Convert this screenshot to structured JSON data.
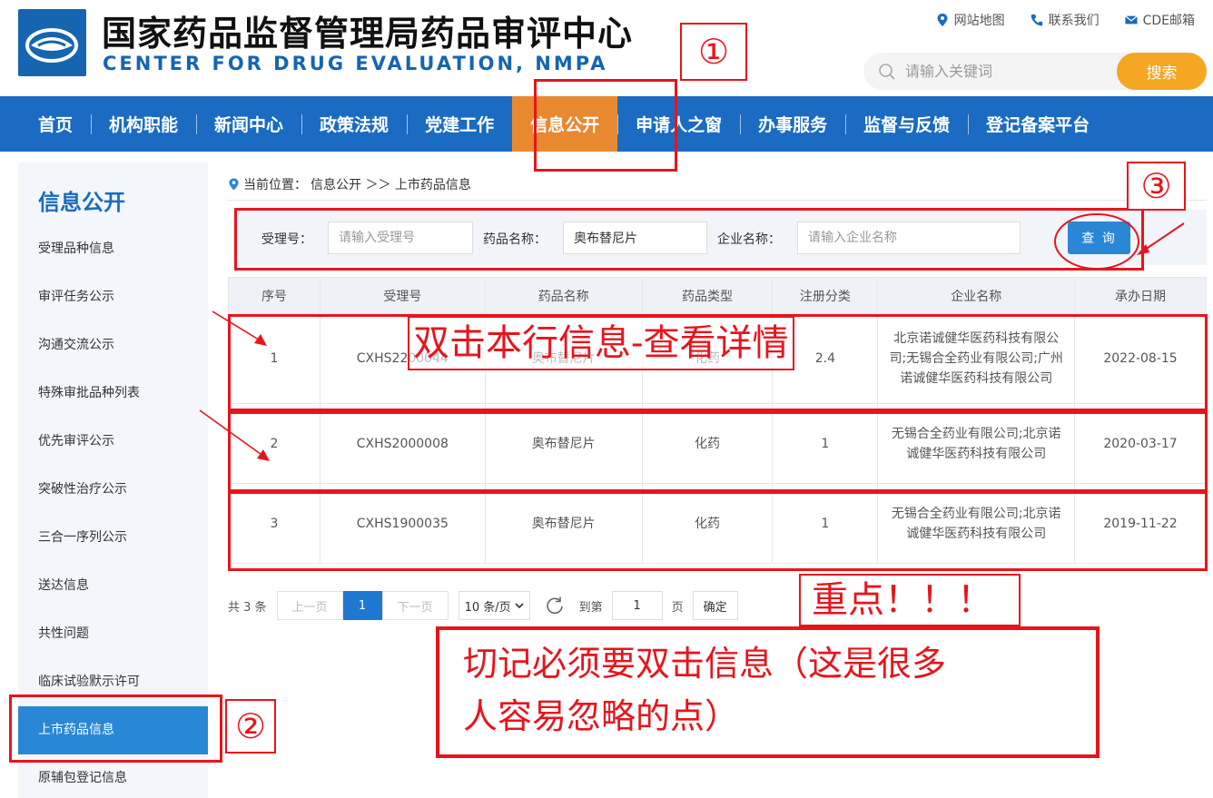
{
  "header": {
    "title_cn": "国家药品监督管理局药品审评中心",
    "title_en": "CENTER FOR DRUG EVALUATION, NMPA",
    "links": [
      {
        "label": "网站地图",
        "icon": "location-pin-icon"
      },
      {
        "label": "联系我们",
        "icon": "phone-icon"
      },
      {
        "label": "CDE邮箱",
        "icon": "mail-icon"
      }
    ],
    "search_placeholder": "请输入关键词",
    "search_button": "搜索"
  },
  "nav": {
    "items": [
      "首页",
      "机构职能",
      "新闻中心",
      "政策法规",
      "党建工作",
      "信息公开",
      "申请人之窗",
      "办事服务",
      "监督与反馈",
      "登记备案平台"
    ],
    "active": "信息公开"
  },
  "sidebar": {
    "title": "信息公开",
    "items": [
      "受理品种信息",
      "审评任务公示",
      "沟通交流公示",
      "特殊审批品种列表",
      "优先审评公示",
      "突破性治疗公示",
      "三合一序列公示",
      "送达信息",
      "共性问题",
      "临床试验默示许可",
      "上市药品信息",
      "原辅包登记信息"
    ],
    "active": "上市药品信息"
  },
  "breadcrumb": {
    "prefix": "当前位置：",
    "path": "信息公开 ＞＞ 上市药品信息"
  },
  "filter": {
    "accept_no_label": "受理号：",
    "accept_no_placeholder": "请输入受理号",
    "drug_name_label": "药品名称：",
    "drug_name_value": "奥布替尼片",
    "company_label": "企业名称：",
    "company_placeholder": "请输入企业名称",
    "query_button": "查 询"
  },
  "table": {
    "columns": [
      "序号",
      "受理号",
      "药品名称",
      "药品类型",
      "注册分类",
      "企业名称",
      "承办日期"
    ],
    "rows": [
      {
        "no": "1",
        "accept_no": "CXHS2200044",
        "drug": "奥布替尼片",
        "type": "化药",
        "category": "2.4",
        "company": "北京诺诚健华医药科技有限公司;无锡合全药业有限公司;广州诺诚健华医药科技有限公司",
        "date": "2022-08-15"
      },
      {
        "no": "2",
        "accept_no": "CXHS2000008",
        "drug": "奥布替尼片",
        "type": "化药",
        "category": "1",
        "company": "无锡合全药业有限公司;北京诺诚健华医药科技有限公司",
        "date": "2020-03-17"
      },
      {
        "no": "3",
        "accept_no": "CXHS1900035",
        "drug": "奥布替尼片",
        "type": "化药",
        "category": "1",
        "company": "无锡合全药业有限公司;北京诺诚健华医药科技有限公司",
        "date": "2019-11-22"
      }
    ]
  },
  "pager": {
    "total": "共 3 条",
    "prev": "上一页",
    "current": "1",
    "next": "下一页",
    "page_size": "10 条/页",
    "goto_label": "到第",
    "goto_value": "1",
    "page_unit": "页",
    "confirm": "确定"
  },
  "annotations": {
    "step1": "①",
    "step2": "②",
    "step3": "③",
    "double_click_hint": "双击本行信息-查看详情",
    "key_point": "重点！！！",
    "note": "切记必须要双击信息（这是很多人容易忽略的点）",
    "note_line1": "切记必须要双击信息（这是很多",
    "note_line2": "人容易忽略的点）",
    "color": "#e8141c"
  },
  "colors": {
    "brand_blue": "#1a6bc1",
    "nav_active": "#e9892f",
    "search_button": "#f5a623",
    "sidebar_active": "#2a87d6"
  }
}
